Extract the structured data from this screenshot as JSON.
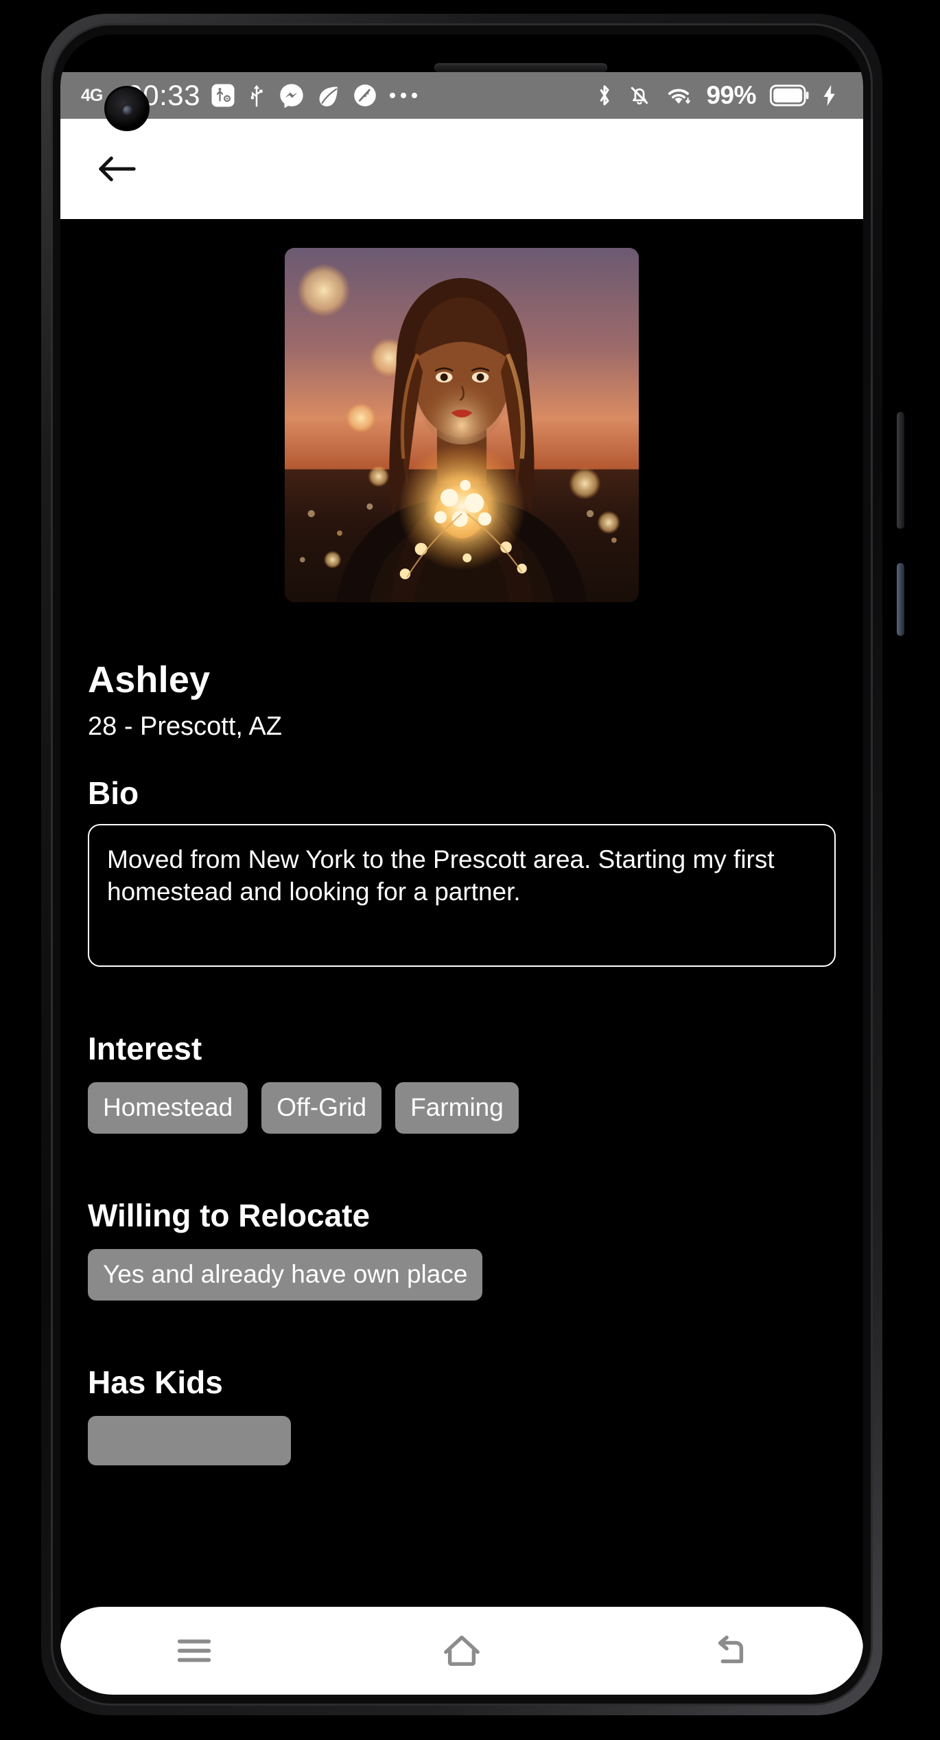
{
  "status_bar": {
    "network": "4G",
    "time": "00:33",
    "left_icons": [
      "usb-debug-icon",
      "usb-icon",
      "messenger-icon",
      "leaf-icon",
      "speedometer-icon",
      "overflow-ellipsis-icon"
    ],
    "right_icons": [
      "bluetooth-icon",
      "bell-muted-icon",
      "wifi-icon",
      "battery-icon",
      "charging-bolt-icon"
    ],
    "battery_percent": "99%",
    "bar_color": "#767676"
  },
  "app_bar": {
    "back_icon": "arrow-left-icon",
    "background": "#ffffff"
  },
  "profile": {
    "photo_alt": "portrait-photo",
    "name": "Ashley",
    "details": "28 -  Prescott, AZ",
    "age": "28",
    "location": "Prescott, AZ"
  },
  "sections": {
    "bio": {
      "title": "Bio",
      "text": "Moved from New York to the Prescott area. Starting my first homestead and looking for a partner."
    },
    "interest": {
      "title": "Interest",
      "chips": [
        "Homestead",
        "Off-Grid",
        "Farming"
      ]
    },
    "relocate": {
      "title": "Willing to Relocate",
      "chips": [
        "Yes and already have own place"
      ]
    },
    "has_kids": {
      "title": "Has Kids",
      "chips": [
        ""
      ]
    }
  },
  "nav_bar": {
    "items": [
      {
        "name": "recents-button",
        "icon": "menu-lines-icon"
      },
      {
        "name": "home-button",
        "icon": "home-icon"
      },
      {
        "name": "back-button",
        "icon": "back-arrow-icon"
      }
    ],
    "background": "#ffffff",
    "icon_color": "#8c8c8c"
  },
  "theme": {
    "page_background": "#000000",
    "text_color": "#ffffff",
    "chip_background": "#8a8a8a",
    "accent_border": "#ffffff"
  }
}
